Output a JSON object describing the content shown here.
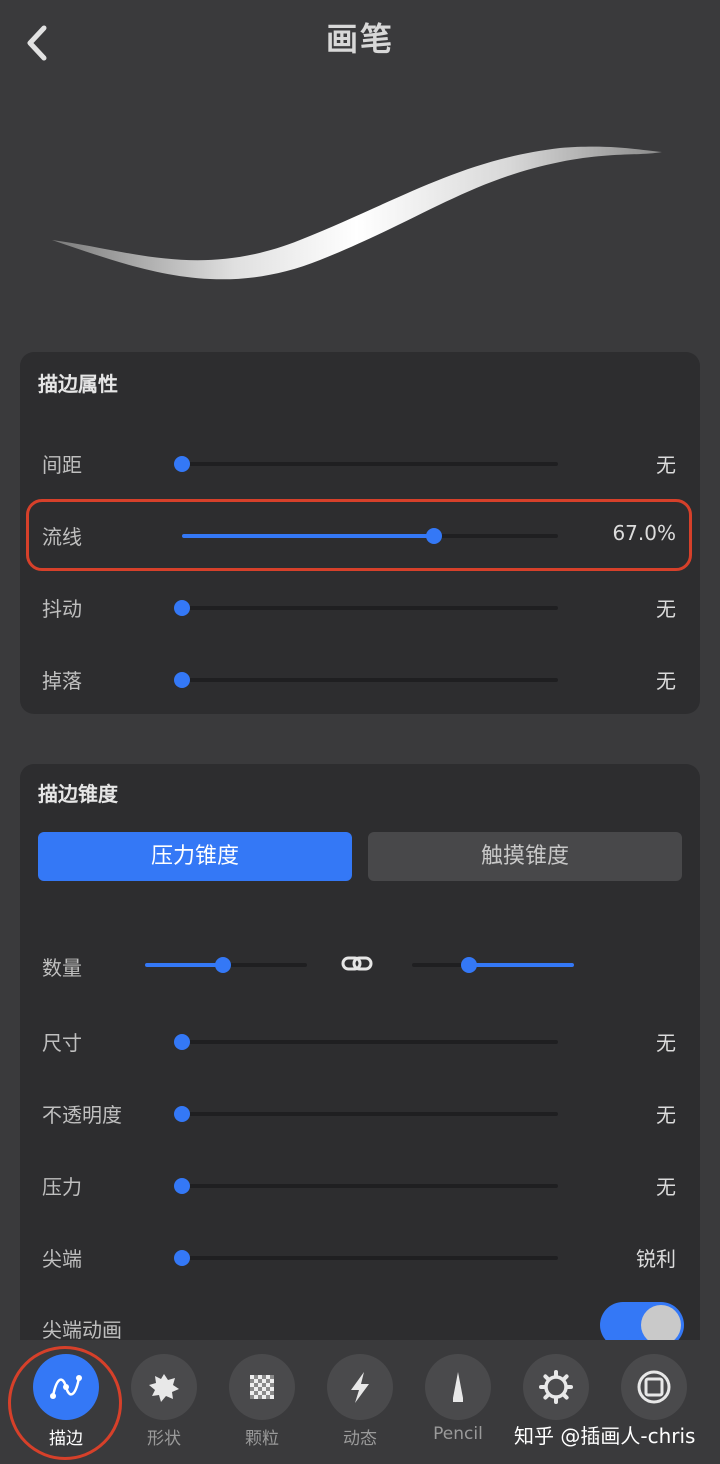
{
  "header": {
    "title": "画笔"
  },
  "section_stroke": {
    "title": "描边属性",
    "rows": [
      {
        "label": "间距",
        "value": "无",
        "level": 0
      },
      {
        "label": "流线",
        "value": "67.0%",
        "level": 0.67
      },
      {
        "label": "抖动",
        "value": "无",
        "level": 0
      },
      {
        "label": "掉落",
        "value": "无",
        "level": 0
      }
    ]
  },
  "section_taper": {
    "title": "描边锥度",
    "tabs": {
      "active": "压力锥度",
      "inactive": "触摸锥度"
    },
    "amount": {
      "label": "数量",
      "left_level": 0.48,
      "right_level": 0.65
    },
    "rows": [
      {
        "label": "尺寸",
        "value": "无",
        "level": 0
      },
      {
        "label": "不透明度",
        "value": "无",
        "level": 0
      },
      {
        "label": "压力",
        "value": "无",
        "level": 0
      },
      {
        "label": "尖端",
        "value": "锐利",
        "level": 0
      }
    ],
    "tip_animation": {
      "label": "尖端动画",
      "on": true
    }
  },
  "tabbar": {
    "items": [
      {
        "label": "描边",
        "icon": "stroke-wave-icon",
        "active": true
      },
      {
        "label": "形状",
        "icon": "shape-blob-icon",
        "active": false
      },
      {
        "label": "颗粒",
        "icon": "grain-checker-icon",
        "active": false
      },
      {
        "label": "动态",
        "icon": "lightning-icon",
        "active": false
      },
      {
        "label": "Pencil",
        "icon": "pencil-tip-icon",
        "active": false
      },
      {
        "label": "",
        "icon": "gear-icon",
        "active": false
      },
      {
        "label": "",
        "icon": "square-icon",
        "active": false
      }
    ]
  },
  "watermark": "知乎 @插画人-chris",
  "colors": {
    "accent": "#3478f6",
    "highlight": "#d6402a",
    "background": "#3a3a3c",
    "card": "#2d2d2f"
  }
}
